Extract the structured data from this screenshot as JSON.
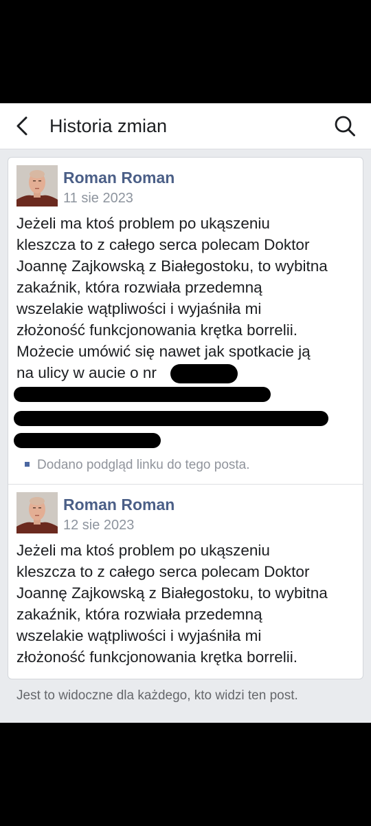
{
  "header": {
    "title": "Historia zmian",
    "back_icon": "chevron-left-icon",
    "search_icon": "search-icon"
  },
  "entries": [
    {
      "author": "Roman Roman",
      "date": "11 sie 2023",
      "text": "Jeżeli ma ktoś problem po ukąszeniu\nkleszcza to z całego serca polecam Doktor\nJoannę Zajkowską z Białegostoku, to wybitna\nzakaźnik, która rozwiała przedemną\nwszelakie wątpliwości i wyjaśniła mi\nzłożoność funkcjonowania krętka borrelii.\nMożecie umówić się nawet jak spotkacie ją\nna ulicy w aucie o nr",
      "note": "Dodano podgląd linku do tego posta."
    },
    {
      "author": "Roman Roman",
      "date": "12 sie 2023",
      "text": "Jeżeli ma ktoś problem po ukąszeniu\nkleszcza to z całego serca polecam Doktor\nJoannę Zajkowską z Białegostoku, to wybitna\nzakaźnik, która rozwiała przedemną\nwszelakie wątpliwości i wyjaśniła mi\nzłożoność funkcjonowania krętka borrelii."
    }
  ],
  "footer_note": "Jest to widoczne dla każdego, kto widzi ten post.",
  "colors": {
    "author": "#4b5f87",
    "link": "#4b67a1",
    "background": "#e9ebee"
  }
}
